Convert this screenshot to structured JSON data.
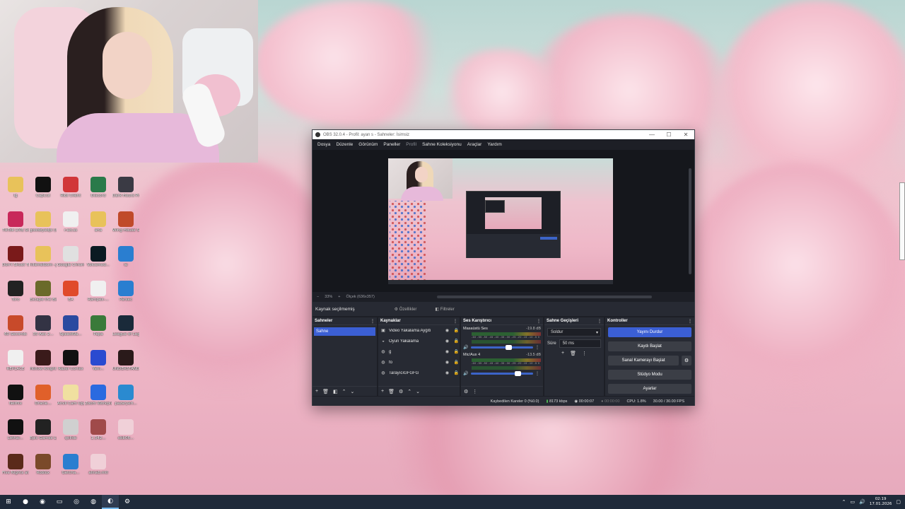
{
  "obs": {
    "title": "OBS 32.0.4 - Profil: ayan s - Sahneler: İsimsiz",
    "window_buttons": [
      "—",
      "☐",
      "✕"
    ],
    "menu": [
      {
        "label": "Dosya",
        "enabled": true
      },
      {
        "label": "Düzenle",
        "enabled": true
      },
      {
        "label": "Görünüm",
        "enabled": true
      },
      {
        "label": "Paneller",
        "enabled": true
      },
      {
        "label": "Profil",
        "enabled": false
      },
      {
        "label": "Sahne Koleksiyonu",
        "enabled": true
      },
      {
        "label": "Araçlar",
        "enabled": true
      },
      {
        "label": "Yardım",
        "enabled": true
      }
    ],
    "zoom": {
      "minus": "−",
      "percent": "33%",
      "plus": "+",
      "size": "Ölçek (636x357)"
    },
    "source_bar": {
      "status": "Kaynak seçilmemiş",
      "properties": "Özellikler",
      "filters": "Filtreler"
    },
    "scenes": {
      "title": "Sahneler",
      "items": [
        "Sahne"
      ]
    },
    "sources": {
      "title": "Kaynaklar",
      "items": [
        {
          "icon": "monitor-icon",
          "label": "Video Yakalama Aygıtı"
        },
        {
          "icon": "gamepad-icon",
          "label": "Oyun Yakalama"
        },
        {
          "icon": "globe-icon",
          "label": "g"
        },
        {
          "icon": "globe-icon",
          "label": "fo"
        },
        {
          "icon": "globe-icon",
          "label": "TarayıcıGFGFG"
        }
      ]
    },
    "mixer": {
      "title": "Ses Karıştırıcı",
      "channels": [
        {
          "name": "Masaüstü Ses",
          "db": "-19.8 dB",
          "level": 0.6
        },
        {
          "name": "Mic/Aux 4",
          "db": "-13.5 dB",
          "level": 0.75
        }
      ],
      "ticks": "-60 -55 -50 -45 -40 -35 -30 -25 -20 -15 -10 -5 0"
    },
    "transitions": {
      "title": "Sahne Geçişleri",
      "selected": "Soldur",
      "duration_label": "Süre",
      "duration": "50 ms"
    },
    "controls": {
      "title": "Kontroller",
      "buttons": [
        {
          "label": "Yayını Durdur",
          "active": true
        },
        {
          "label": "Kaydı Başlat",
          "active": false
        },
        {
          "label": "Sanal Kamerayı Başlat",
          "active": false
        },
        {
          "label": "Stüdyo Modu",
          "active": false
        },
        {
          "label": "Ayarlar",
          "active": false
        }
      ]
    },
    "status": {
      "dropped": "Kaybedilen Kareler 0 (%0.0)",
      "bitrate": "8173 kbps",
      "stream_time": "00:00:07",
      "rec_time": "00:00:00",
      "cpu": "CPU: 1.8%",
      "fps": "30.00 / 30.00 FPS"
    }
  },
  "desktop_icons": [
    {
      "label": "lg",
      "color": "#e8c25a"
    },
    {
      "label": "CapCut",
      "color": "#111111"
    },
    {
      "label": "Riot Client",
      "color": "#d13639"
    },
    {
      "label": "Discord",
      "color": "#2a7a4a"
    },
    {
      "label": "Dark Hours Prologue",
      "color": "#3a3a44"
    },
    {
      "label": "TikTok LIVE Studio",
      "color": "#c8285a"
    },
    {
      "label": "goodbyedpi (8)",
      "color": "#e8c25a"
    },
    {
      "label": "r-ed.ss",
      "color": "#f0f0f0"
    },
    {
      "label": "ana",
      "color": "#e8c25a"
    },
    {
      "label": "Wing House Simulator S...",
      "color": "#c04a2a"
    },
    {
      "label": "Don't Shoot Together",
      "color": "#7a1a1a"
    },
    {
      "label": "hilemelbom -gedir",
      "color": "#e8c25a"
    },
    {
      "label": "Google Chrome",
      "color": "#e0e0e0"
    },
    {
      "label": "Voicemod...",
      "color": "#0a1a22"
    },
    {
      "label": "ie",
      "color": "#2a7ed0"
    },
    {
      "label": "Toro",
      "color": "#222222"
    },
    {
      "label": "Escape the Backrooms",
      "color": "#6a6a2a"
    },
    {
      "label": "EA",
      "color": "#e04a2a"
    },
    {
      "label": "Rampex-...",
      "color": "#f0f0f0"
    },
    {
      "label": "Parsec",
      "color": "#2a7ed0"
    },
    {
      "label": "60 Seconds",
      "color": "#c84a2a"
    },
    {
      "label": "35 Aes 2...",
      "color": "#333344"
    },
    {
      "label": "SpeedWa...",
      "color": "#2a4aa0"
    },
    {
      "label": "Papa",
      "color": "#3a7a3a"
    },
    {
      "label": "League of Legends",
      "color": "#1a2a3a"
    },
    {
      "label": "REPLACE",
      "color": "#f0f0f0"
    },
    {
      "label": "Hollow Knight",
      "color": "#3a1a1a"
    },
    {
      "label": "Razer Cortex",
      "color": "#111111"
    },
    {
      "label": "Yeni...",
      "color": "#2a4ad0"
    },
    {
      "label": "UNDERSTAND",
      "color": "#2a1a1a"
    },
    {
      "label": "Netflix",
      "color": "#111111"
    },
    {
      "label": "Oracle...",
      "color": "#e0602a"
    },
    {
      "label": "Anvil Cam Upgrade...",
      "color": "#f0e0a0"
    },
    {
      "label": "Zoom Workplace",
      "color": "#2a6ae0"
    },
    {
      "label": "pazaryeri...",
      "color": "#2a8ad0"
    },
    {
      "label": "Lethal...",
      "color": "#111111"
    },
    {
      "label": "Epic Games Launcher",
      "color": "#222222"
    },
    {
      "label": "qolide",
      "color": "#d0d0d0"
    },
    {
      "label": "1.342...",
      "color": "#a04a4a"
    },
    {
      "label": "obb06...",
      "color": "#f0d0d8"
    },
    {
      "label": "Five Nights at Freddy's 4",
      "color": "#5a2a1a"
    },
    {
      "label": "Roblox",
      "color": "#7a4a2a"
    },
    {
      "label": "Getcha...",
      "color": "#2a7ed0"
    },
    {
      "label": "alinab.mtl",
      "color": "#f0d0d8"
    }
  ],
  "taskbar": {
    "icons": [
      {
        "name": "windows-start-icon",
        "glyph": "⊞"
      },
      {
        "name": "firefox-icon",
        "glyph": "●"
      },
      {
        "name": "edge-icon",
        "glyph": "◉"
      },
      {
        "name": "file-explorer-icon",
        "glyph": "▭"
      },
      {
        "name": "chrome-icon",
        "glyph": "◎"
      },
      {
        "name": "steam-icon",
        "glyph": "◍"
      },
      {
        "name": "obs-icon",
        "glyph": "◐"
      },
      {
        "name": "settings-icon",
        "glyph": "⚙"
      }
    ],
    "time": "02:19",
    "date": "17.01.2026"
  }
}
